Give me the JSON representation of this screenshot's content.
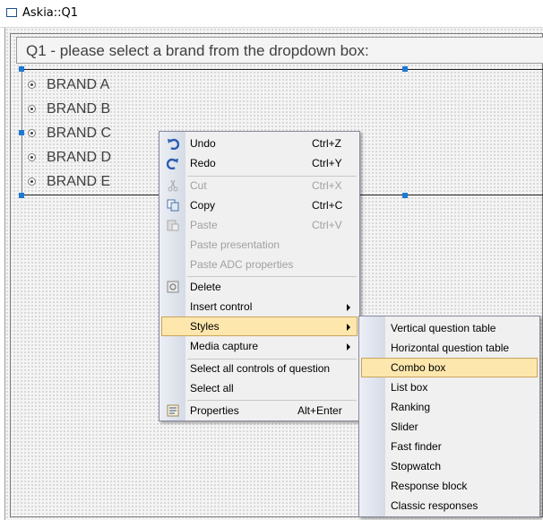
{
  "window": {
    "title": "Askia::Q1"
  },
  "question": {
    "label": "Q1 - please select a brand from the dropdown box:",
    "responses": [
      "BRAND A",
      "BRAND B",
      "BRAND C",
      "BRAND D",
      "BRAND E"
    ]
  },
  "context_menu": {
    "undo": {
      "label": "Undo",
      "shortcut": "Ctrl+Z"
    },
    "redo": {
      "label": "Redo",
      "shortcut": "Ctrl+Y"
    },
    "cut": {
      "label": "Cut",
      "shortcut": "Ctrl+X"
    },
    "copy": {
      "label": "Copy",
      "shortcut": "Ctrl+C"
    },
    "paste": {
      "label": "Paste",
      "shortcut": "Ctrl+V"
    },
    "paste_presentation": {
      "label": "Paste presentation"
    },
    "paste_adc": {
      "label": "Paste ADC properties"
    },
    "delete": {
      "label": "Delete"
    },
    "insert_control": {
      "label": "Insert control"
    },
    "styles": {
      "label": "Styles"
    },
    "media_capture": {
      "label": "Media capture"
    },
    "select_all_controls": {
      "label": "Select all controls of question"
    },
    "select_all": {
      "label": "Select all"
    },
    "properties": {
      "label": "Properties",
      "shortcut": "Alt+Enter"
    }
  },
  "styles_submenu": {
    "items": [
      "Vertical question table",
      "Horizontal question table",
      "Combo box",
      "List box",
      "Ranking",
      "Slider",
      "Fast finder",
      "Stopwatch",
      "Response block",
      "Classic responses"
    ],
    "selected": "Combo box"
  },
  "colors": {
    "highlight": "#fde7ad",
    "selection_handle": "#1e78d6"
  }
}
